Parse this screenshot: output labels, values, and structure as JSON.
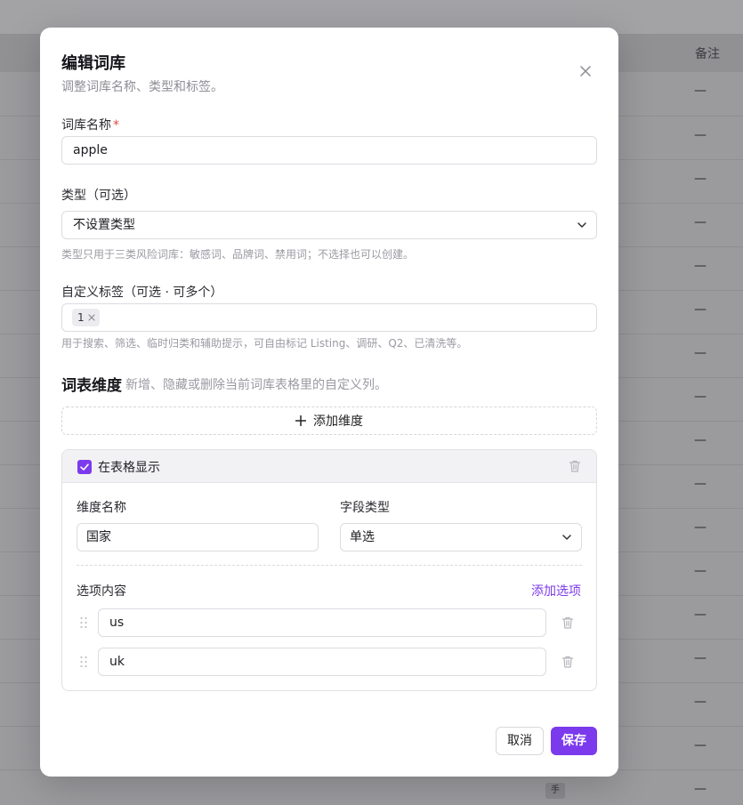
{
  "background": {
    "column_header_remark": "备注",
    "row_placeholder": "—",
    "chip_text": "手"
  },
  "modal": {
    "title": "编辑词库",
    "subtitle": "调整词库名称、类型和标签。",
    "close_icon": "close-icon"
  },
  "name_field": {
    "label": "词库名称",
    "required_mark": "*",
    "value": "apple"
  },
  "type_field": {
    "label": "类型（可选）",
    "selected": "不设置类型",
    "hint": "类型只用于三类风险词库：敏感词、品牌词、禁用词；不选择也可以创建。"
  },
  "tags_field": {
    "label": "自定义标签（可选 · 可多个）",
    "tags": [
      "1"
    ],
    "hint": "用于搜索、筛选、临时归类和辅助提示，可自由标记 Listing、调研、Q2、已清洗等。"
  },
  "dimensions": {
    "title": "词表维度",
    "description": "新增、隐藏或删除当前词库表格里的自定义列。",
    "add_label": "添加维度",
    "items": [
      {
        "show_in_table_label": "在表格显示",
        "show_in_table": true,
        "name_label": "维度名称",
        "name_value": "国家",
        "field_type_label": "字段类型",
        "field_type_value": "单选",
        "options_label": "选项内容",
        "add_option_label": "添加选项",
        "options": [
          "us",
          "uk"
        ]
      }
    ]
  },
  "footer": {
    "cancel_label": "取消",
    "save_label": "保存"
  },
  "colors": {
    "accent": "#7c3aed",
    "required": "#e5483c"
  }
}
